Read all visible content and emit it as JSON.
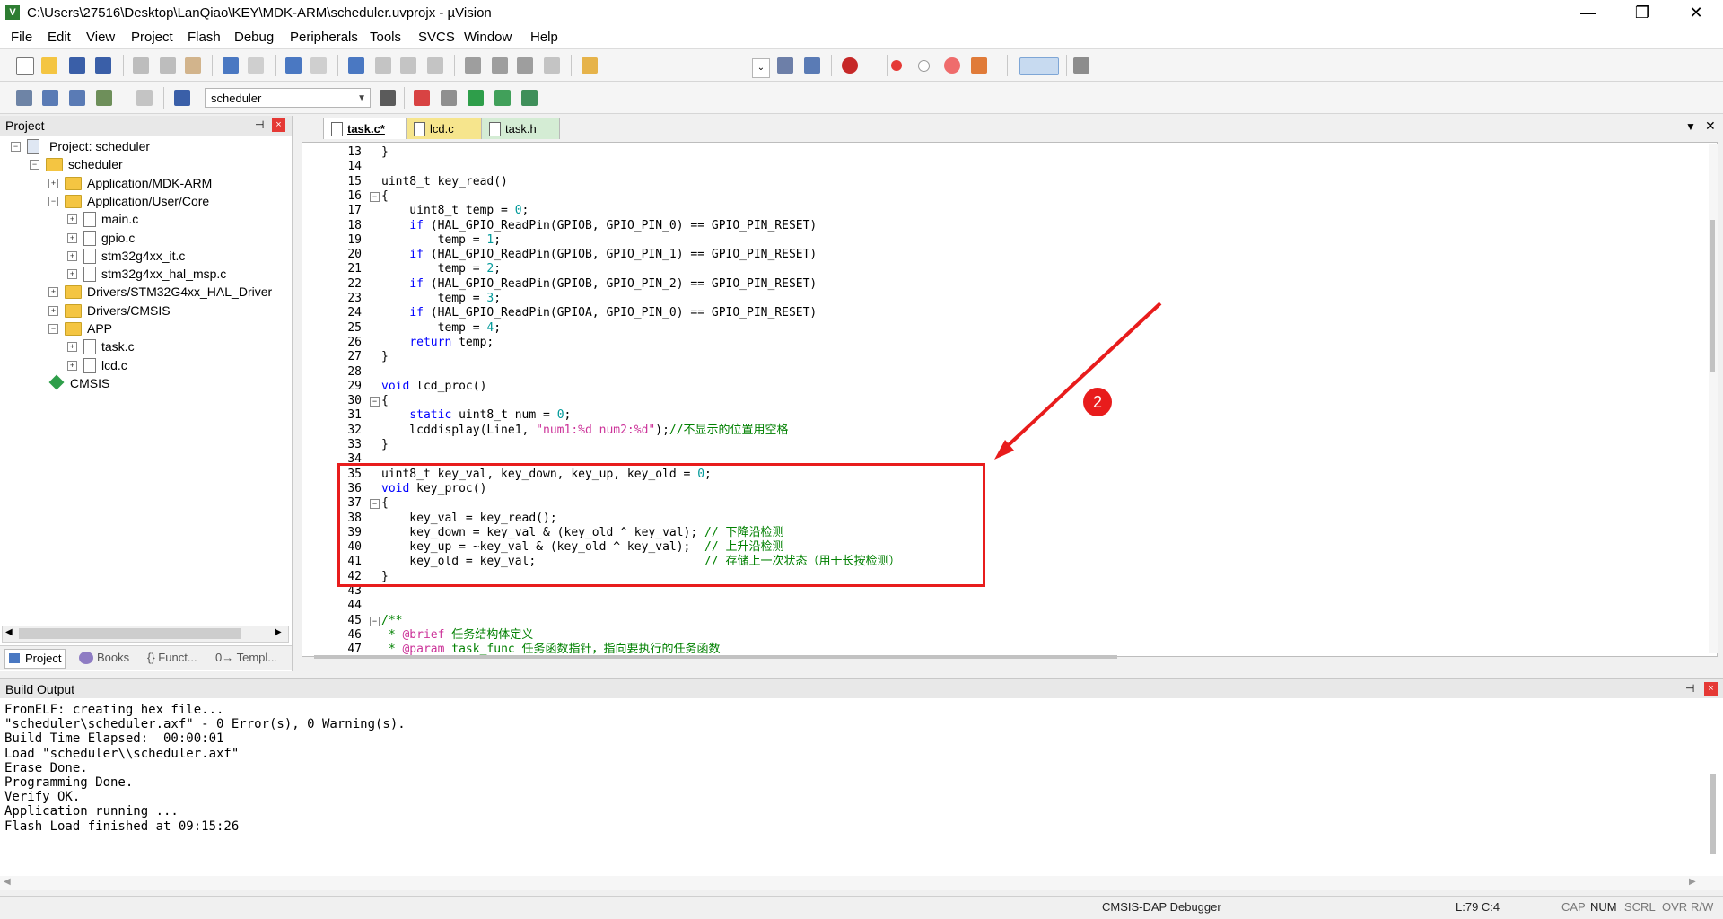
{
  "window": {
    "title": "C:\\Users\\27516\\Desktop\\LanQiao\\KEY\\MDK-ARM\\scheduler.uvprojx - µVision",
    "minimize": "—",
    "maximize": "❐",
    "close": "✕"
  },
  "menu": [
    "File",
    "Edit",
    "View",
    "Project",
    "Flash",
    "Debug",
    "Peripherals",
    "Tools",
    "SVCS",
    "Window",
    "Help"
  ],
  "toolbar2": {
    "target": "scheduler"
  },
  "project_panel": {
    "title": "Project",
    "pin": "⊣",
    "close": "×",
    "tree": [
      {
        "label": "Project: scheduler",
        "level": 0,
        "kind": "project",
        "expander": "-"
      },
      {
        "label": "scheduler",
        "level": 1,
        "kind": "target",
        "expander": "-"
      },
      {
        "label": "Application/MDK-ARM",
        "level": 2,
        "kind": "folder",
        "expander": "+"
      },
      {
        "label": "Application/User/Core",
        "level": 2,
        "kind": "folder",
        "expander": "-"
      },
      {
        "label": "main.c",
        "level": 3,
        "kind": "file",
        "expander": "+"
      },
      {
        "label": "gpio.c",
        "level": 3,
        "kind": "file",
        "expander": "+"
      },
      {
        "label": "stm32g4xx_it.c",
        "level": 3,
        "kind": "file",
        "expander": "+"
      },
      {
        "label": "stm32g4xx_hal_msp.c",
        "level": 3,
        "kind": "file",
        "expander": "+"
      },
      {
        "label": "Drivers/STM32G4xx_HAL_Driver",
        "level": 2,
        "kind": "folder",
        "expander": "+"
      },
      {
        "label": "Drivers/CMSIS",
        "level": 2,
        "kind": "folder",
        "expander": "+"
      },
      {
        "label": "APP",
        "level": 2,
        "kind": "folder",
        "expander": "-"
      },
      {
        "label": "task.c",
        "level": 3,
        "kind": "file",
        "expander": "+"
      },
      {
        "label": "lcd.c",
        "level": 3,
        "kind": "file",
        "expander": "+"
      },
      {
        "label": "CMSIS",
        "level": 2,
        "kind": "component",
        "expander": ""
      }
    ],
    "tabs": [
      "Project",
      "Books",
      "{} Funct...",
      "0→ Templ..."
    ]
  },
  "editor": {
    "tabs": [
      {
        "label": "task.c*",
        "active": true,
        "color": "#ffffff"
      },
      {
        "label": "lcd.c",
        "active": false,
        "color": "#f6e58d"
      },
      {
        "label": "task.h",
        "active": false,
        "color": "#d4ecd4"
      }
    ],
    "lines": [
      {
        "n": "13",
        "fold": "",
        "html": "}"
      },
      {
        "n": "14",
        "fold": "",
        "html": ""
      },
      {
        "n": "15",
        "fold": "",
        "html": "uint8_t key_read()"
      },
      {
        "n": "16",
        "fold": "-",
        "html": "{"
      },
      {
        "n": "17",
        "fold": "",
        "html": "    uint8_t temp = <span class=\"num\">0</span>;"
      },
      {
        "n": "18",
        "fold": "",
        "html": "    <span class=\"kw\">if</span> (HAL_GPIO_ReadPin(GPIOB, GPIO_PIN_0) == GPIO_PIN_RESET)"
      },
      {
        "n": "19",
        "fold": "",
        "html": "        temp = <span class=\"num\">1</span>;"
      },
      {
        "n": "20",
        "fold": "",
        "html": "    <span class=\"kw\">if</span> (HAL_GPIO_ReadPin(GPIOB, GPIO_PIN_1) == GPIO_PIN_RESET)"
      },
      {
        "n": "21",
        "fold": "",
        "html": "        temp = <span class=\"num\">2</span>;"
      },
      {
        "n": "22",
        "fold": "",
        "html": "    <span class=\"kw\">if</span> (HAL_GPIO_ReadPin(GPIOB, GPIO_PIN_2) == GPIO_PIN_RESET)"
      },
      {
        "n": "23",
        "fold": "",
        "html": "        temp = <span class=\"num\">3</span>;"
      },
      {
        "n": "24",
        "fold": "",
        "html": "    <span class=\"kw\">if</span> (HAL_GPIO_ReadPin(GPIOA, GPIO_PIN_0) == GPIO_PIN_RESET)"
      },
      {
        "n": "25",
        "fold": "",
        "html": "        temp = <span class=\"num\">4</span>;"
      },
      {
        "n": "26",
        "fold": "",
        "html": "    <span class=\"kw\">return</span> temp;"
      },
      {
        "n": "27",
        "fold": "",
        "html": "}"
      },
      {
        "n": "28",
        "fold": "",
        "html": ""
      },
      {
        "n": "29",
        "fold": "",
        "html": "<span class=\"kw\">void</span> lcd_proc()"
      },
      {
        "n": "30",
        "fold": "-",
        "html": "{"
      },
      {
        "n": "31",
        "fold": "",
        "html": "    <span class=\"kw\">static</span> uint8_t num = <span class=\"num\">0</span>;"
      },
      {
        "n": "32",
        "fold": "",
        "html": "    lcddisplay(Line1, <span class=\"str\">\"num1:%d num2:%d\"</span>);<span class=\"cmt\">//不显示的位置用空格</span>"
      },
      {
        "n": "33",
        "fold": "",
        "html": "}"
      },
      {
        "n": "34",
        "fold": "",
        "html": ""
      },
      {
        "n": "35",
        "fold": "",
        "html": "uint8_t key_val, key_down, key_up, key_old = <span class=\"num\">0</span>;"
      },
      {
        "n": "36",
        "fold": "",
        "html": "<span class=\"kw\">void</span> key_proc()"
      },
      {
        "n": "37",
        "fold": "-",
        "html": "{"
      },
      {
        "n": "38",
        "fold": "",
        "html": "    key_val = key_read();"
      },
      {
        "n": "39",
        "fold": "",
        "html": "    key_down = key_val &amp; (key_old ^ key_val); <span class=\"cmt\">// 下降沿检测</span>"
      },
      {
        "n": "40",
        "fold": "",
        "html": "    key_up = ~key_val &amp; (key_old ^ key_val);  <span class=\"cmt\">// 上升沿检测</span>"
      },
      {
        "n": "41",
        "fold": "",
        "html": "    key_old = key_val;                        <span class=\"cmt\">// 存储上一次状态（用于长按检测）</span>"
      },
      {
        "n": "42",
        "fold": "",
        "html": "}"
      },
      {
        "n": "43",
        "fold": "",
        "html": ""
      },
      {
        "n": "44",
        "fold": "",
        "html": ""
      },
      {
        "n": "45",
        "fold": "-",
        "html": "<span class=\"doc\">/**</span>"
      },
      {
        "n": "46",
        "fold": "",
        "html": "<span class=\"doc\"> * </span><span class=\"str\">@brief</span><span class=\"doc\"> 任务结构体定义</span>"
      },
      {
        "n": "47",
        "fold": "",
        "html": "<span class=\"doc\"> * </span><span class=\"str\">@param</span><span class=\"doc\"> task_func 任务函数指针，指向要执行的任务函数</span>"
      }
    ],
    "annotation_badge": "2"
  },
  "build_output": {
    "title": "Build Output",
    "lines": [
      "FromELF: creating hex file...",
      "\"scheduler\\scheduler.axf\" - 0 Error(s), 0 Warning(s).",
      "Build Time Elapsed:  00:00:01",
      "Load \"scheduler\\\\scheduler.axf\"",
      "Erase Done.",
      "Programming Done.",
      "Verify OK.",
      "Application running ...",
      "Flash Load finished at 09:15:26"
    ]
  },
  "statusbar": {
    "debugger": "CMSIS-DAP Debugger",
    "position": "L:79 C:4",
    "caps": "CAP",
    "num": "NUM",
    "scrl": "SCRL",
    "ovr": "OVR",
    "rw": "R/W"
  },
  "colors": {
    "highlight": "#e81c1c",
    "keyword": "#0000ff",
    "number": "#009999",
    "string": "#cc3399",
    "comment": "#008000"
  }
}
